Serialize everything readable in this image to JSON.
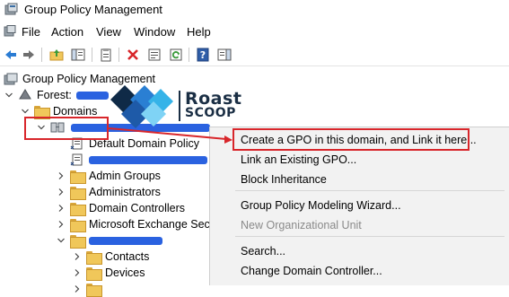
{
  "window": {
    "title": "Group Policy Management"
  },
  "menu": [
    "File",
    "Action",
    "View",
    "Window",
    "Help"
  ],
  "toolbar": {
    "icons": [
      "back-arrow-icon",
      "forward-arrow-icon",
      "up-folder-icon",
      "show-hide-tree-icon",
      "clipboard-icon",
      "delete-icon",
      "properties-icon",
      "refresh-icon",
      "help-icon",
      "panel-icon"
    ]
  },
  "tree": {
    "root_label": "Group Policy Management",
    "forest_label": "Forest:",
    "domains_label": "Domains",
    "gpo_default": "Default Domain Policy",
    "folders": [
      "Admin Groups",
      "Administrators",
      "Domain Controllers",
      "Microsoft Exchange Secu"
    ],
    "subfolders": [
      "Contacts",
      "Devices"
    ]
  },
  "logo": {
    "line1": "Roast",
    "line2": "SCOOP"
  },
  "context_menu": {
    "items": [
      {
        "label": "Create a GPO in this domain, and Link it here...",
        "disabled": false
      },
      {
        "label": "Link an Existing GPO...",
        "disabled": false
      },
      {
        "label": "Block Inheritance",
        "disabled": false
      },
      {
        "label": "Group Policy Modeling Wizard...",
        "disabled": false
      },
      {
        "label": "New Organizational Unit",
        "disabled": true
      },
      {
        "label": "Search...",
        "disabled": false
      },
      {
        "label": "Change Domain Controller...",
        "disabled": false
      }
    ]
  },
  "colors": {
    "highlight": "#d8262b",
    "redaction": "#2a62e0",
    "menu_bg": "#f2f2f2"
  }
}
